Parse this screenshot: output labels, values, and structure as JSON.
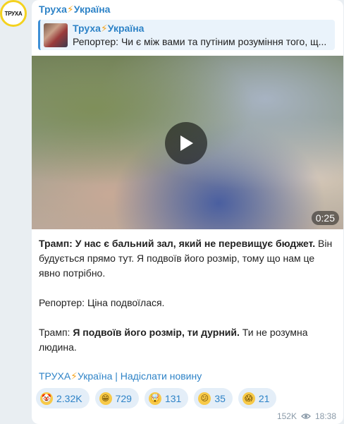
{
  "avatar_text": "ТРУХА",
  "channel": {
    "name": "Труха",
    "bolt": "⚡",
    "suffix": "Україна"
  },
  "quote": {
    "name_prefix": "Труха",
    "bolt": "⚡",
    "name_suffix": "Україна",
    "text": "Репортер: Чи є між вами та путіним розуміння того, щ..."
  },
  "video": {
    "duration": "0:25"
  },
  "message": {
    "p1_bold": "Трамп: У нас є бальний зал, який не перевищує бюджет.",
    "p1_rest": " Він будується прямо тут. Я подвоїв його розмір, тому що нам це явно потрібно.",
    "p2": "Репортер: Ціна подвоїлася.",
    "p3_lead": "Трамп: ",
    "p3_bold": "Я подвоїв його розмір, ти дурний.",
    "p3_rest": " Ти не розумна людина."
  },
  "footer": {
    "prefix": "ТРУХА",
    "bolt": "⚡",
    "text": "Україна | Надіслати новину"
  },
  "reactions": [
    {
      "icon": "clown-face-icon",
      "glyph": "🤡",
      "count": "2.32K"
    },
    {
      "icon": "grinning-face-icon",
      "glyph": "😁",
      "count": "729"
    },
    {
      "icon": "exploding-head-icon",
      "glyph": "🤯",
      "count": "131"
    },
    {
      "icon": "confused-face-icon",
      "glyph": "😕",
      "count": "35"
    },
    {
      "icon": "screaming-face-icon",
      "glyph": "😱",
      "count": "21"
    }
  ],
  "meta": {
    "views": "152K",
    "time": "18:38"
  }
}
